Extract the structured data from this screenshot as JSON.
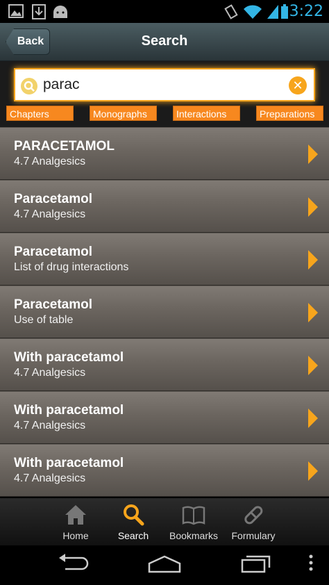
{
  "status": {
    "time": "3:22"
  },
  "header": {
    "back_label": "Back",
    "title": "Search"
  },
  "search": {
    "value": "parac"
  },
  "filters": [
    "Chapters",
    "Monographs",
    "Interactions",
    "Preparations"
  ],
  "results": [
    {
      "title": "PARACETAMOL",
      "subtitle": "4.7 Analgesics"
    },
    {
      "title": "Paracetamol",
      "subtitle": "4.7 Analgesics"
    },
    {
      "title": "Paracetamol",
      "subtitle": "List of drug interactions"
    },
    {
      "title": "Paracetamol",
      "subtitle": "Use of table"
    },
    {
      "title": "With paracetamol",
      "subtitle": "4.7 Analgesics"
    },
    {
      "title": "With paracetamol",
      "subtitle": "4.7 Analgesics"
    },
    {
      "title": "With paracetamol",
      "subtitle": "4.7 Analgesics"
    }
  ],
  "tabs": [
    {
      "label": "Home",
      "icon": "home-icon"
    },
    {
      "label": "Search",
      "icon": "search-icon"
    },
    {
      "label": "Bookmarks",
      "icon": "book-icon"
    },
    {
      "label": "Formulary",
      "icon": "pill-icon"
    }
  ],
  "colors": {
    "accent": "#f7a51c",
    "filter": "#f7881f",
    "time": "#33b5e5"
  }
}
